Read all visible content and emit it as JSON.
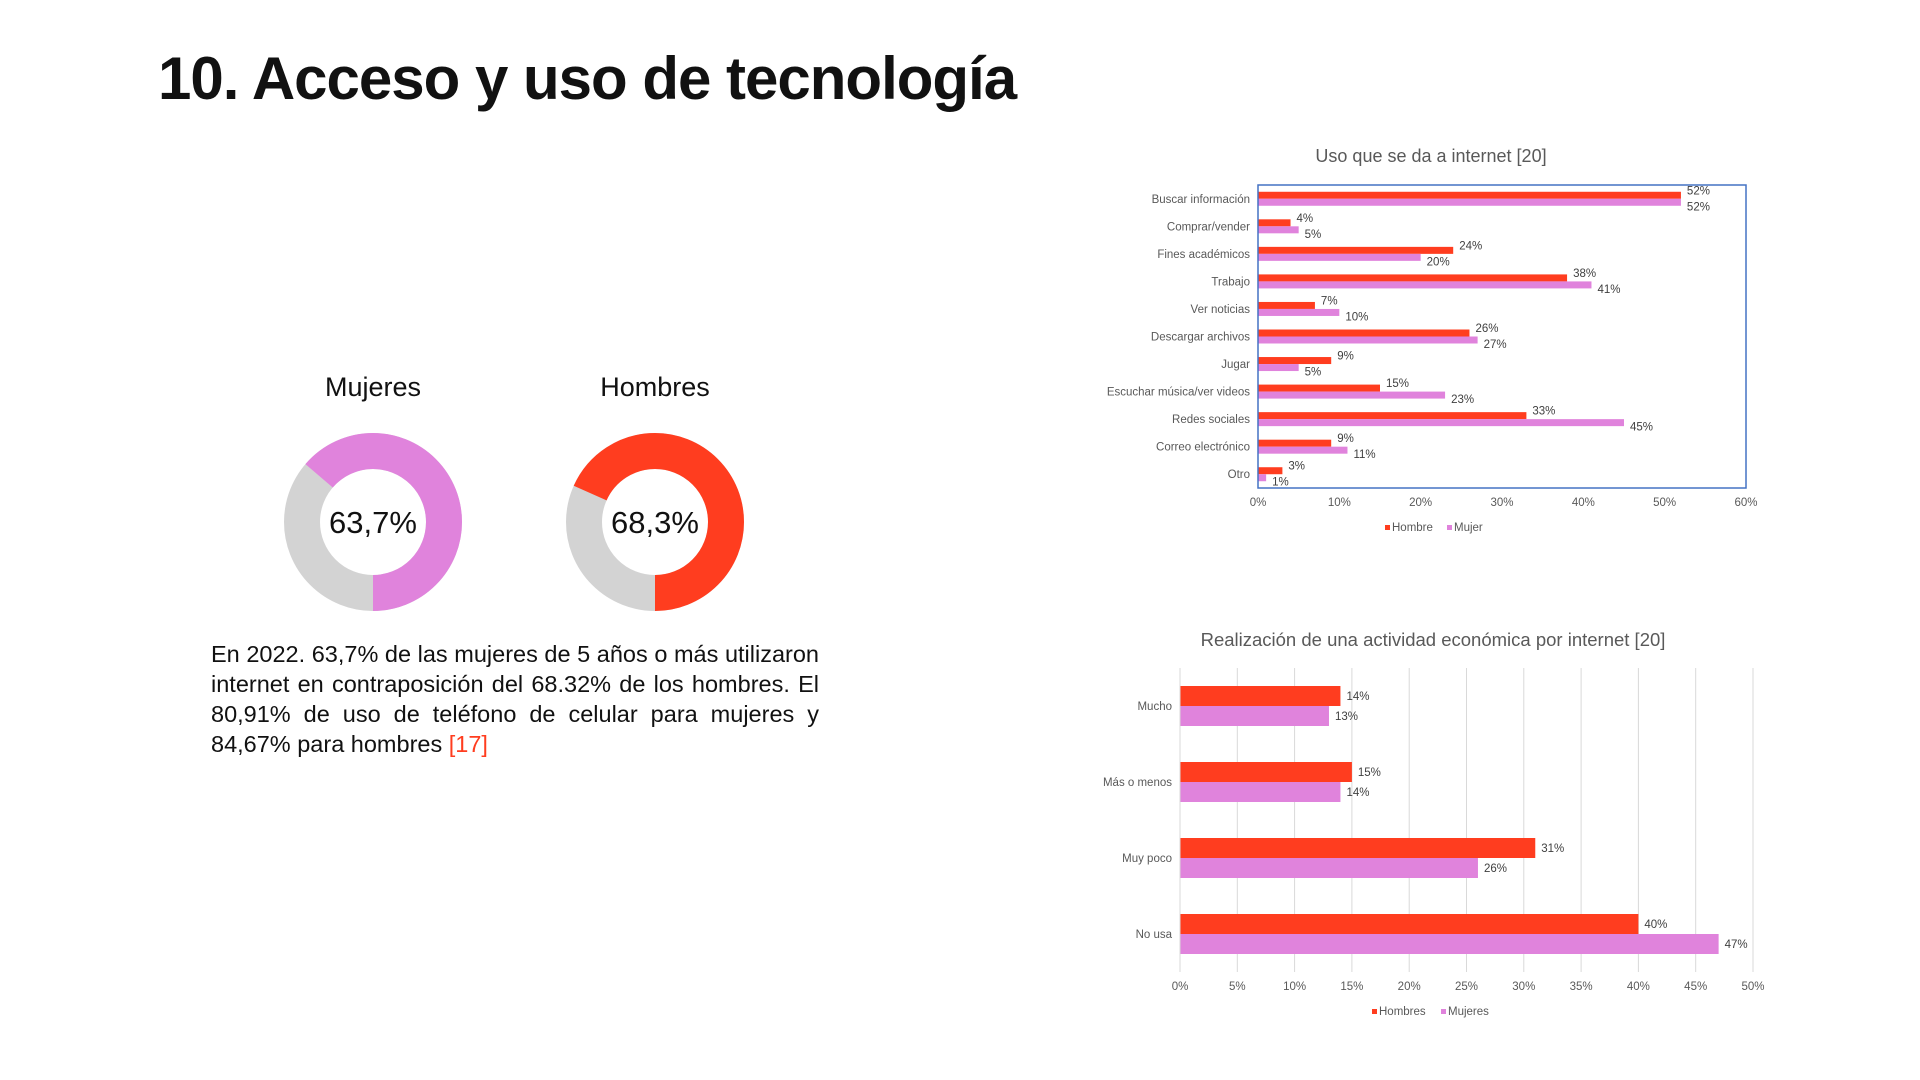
{
  "page": {
    "title": "10. Acceso y uso de tecnología",
    "summary_text": "En 2022. 63,7% de las mujeres de 5 años o más utilizaron internet en contraposición del 68.32% de los hombres. El 80,91% de uso de teléfono de celular para mujeres y 84,67% para hombres ",
    "summary_ref": "[17]"
  },
  "colors": {
    "hombre": "#ff3d1f",
    "mujer": "#e083dc",
    "remainder": "#d3d3d3",
    "plot_border": "#4472c4",
    "grid": "#d9d9d9"
  },
  "chart_data": [
    {
      "type": "pie",
      "variant": "donut",
      "title": "Mujeres",
      "center_label": "63,7%",
      "value": 63.7,
      "color": "#e083dc"
    },
    {
      "type": "pie",
      "variant": "donut",
      "title": "Hombres",
      "center_label": "68,3%",
      "value": 68.3,
      "color": "#ff3d1f"
    },
    {
      "type": "bar",
      "orientation": "horizontal",
      "title": "Uso que se da a internet [20]",
      "categories": [
        "Buscar información",
        "Comprar/vender",
        "Fines académicos",
        "Trabajo",
        "Ver noticias",
        "Descargar archivos",
        "Jugar",
        "Escuchar música/ver videos",
        "Redes sociales",
        "Correo electrónico",
        "Otro"
      ],
      "series": [
        {
          "name": "Hombre",
          "color": "#ff3d1f",
          "values": [
            52,
            4,
            24,
            38,
            7,
            26,
            9,
            15,
            33,
            9,
            3
          ]
        },
        {
          "name": "Mujer",
          "color": "#e083dc",
          "values": [
            52,
            5,
            20,
            41,
            10,
            27,
            5,
            23,
            45,
            11,
            1
          ]
        }
      ],
      "value_suffix": "%",
      "xlim": [
        0,
        60
      ],
      "xticks": [
        "0%",
        "10%",
        "20%",
        "30%",
        "40%",
        "50%",
        "60%"
      ],
      "grid": false,
      "legend_position": "bottom"
    },
    {
      "type": "bar",
      "orientation": "horizontal",
      "title": "Realización de una actividad económica por internet [20]",
      "categories": [
        "Mucho",
        "Más o menos",
        "Muy poco",
        "No usa"
      ],
      "series": [
        {
          "name": "Hombres",
          "color": "#ff3d1f",
          "values": [
            14,
            15,
            31,
            40
          ]
        },
        {
          "name": "Mujeres",
          "color": "#e083dc",
          "values": [
            13,
            14,
            26,
            47
          ]
        }
      ],
      "value_suffix": "%",
      "xlim": [
        0,
        50
      ],
      "xticks": [
        "0%",
        "5%",
        "10%",
        "15%",
        "20%",
        "25%",
        "30%",
        "35%",
        "40%",
        "45%",
        "50%"
      ],
      "grid": true,
      "legend_position": "bottom"
    }
  ]
}
